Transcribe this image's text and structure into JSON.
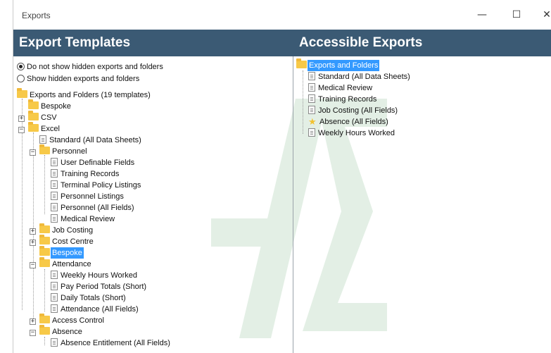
{
  "window": {
    "title": "Exports",
    "minimize_glyph": "—",
    "maximize_glyph": "☐",
    "close_glyph": "✕"
  },
  "left_panel": {
    "header": "Export Templates",
    "radio_options": [
      {
        "label": "Do not show hidden exports and folders",
        "checked": true
      },
      {
        "label": "Show hidden exports and folders",
        "checked": false
      }
    ],
    "tree": {
      "root": "Exports and Folders (19 templates)",
      "bespoke": "Bespoke",
      "csv": "CSV",
      "excel": "Excel",
      "standard": "Standard (All Data Sheets)",
      "personnel": "Personnel",
      "user_definable": "User Definable Fields",
      "training_records": "Training Records",
      "terminal_policy": "Terminal Policy Listings",
      "personnel_listings": "Personnel Listings",
      "personnel_all": "Personnel (All Fields)",
      "medical_review": "Medical Review",
      "job_costing": "Job Costing",
      "cost_centre": "Cost Centre",
      "bespoke_selected": "Bespoke",
      "attendance": "Attendance",
      "weekly_hours": "Weekly Hours Worked",
      "pay_period": "Pay Period Totals (Short)",
      "daily_totals": "Daily Totals (Short)",
      "attendance_all": "Attendance (All Fields)",
      "access_control": "Access Control",
      "absence": "Absence",
      "absence_entitlement": "Absence Entitlement (All Fields)"
    }
  },
  "right_panel": {
    "header": "Accessible Exports",
    "tree": {
      "root": "Exports and Folders",
      "items": [
        {
          "label": "Standard (All Data Sheets)",
          "icon": "document-icon"
        },
        {
          "label": "Medical Review",
          "icon": "document-icon"
        },
        {
          "label": "Training Records",
          "icon": "document-icon"
        },
        {
          "label": "Job Costing (All Fields)",
          "icon": "document-icon"
        },
        {
          "label": "Absence (All Fields)",
          "icon": "star-icon"
        },
        {
          "label": "Weekly Hours Worked",
          "icon": "document-icon"
        }
      ]
    }
  },
  "colors": {
    "header_bg": "#3b5a74",
    "selection": "#3399ff",
    "folder": "#f7c948",
    "watermark": "#2e8b3e"
  }
}
